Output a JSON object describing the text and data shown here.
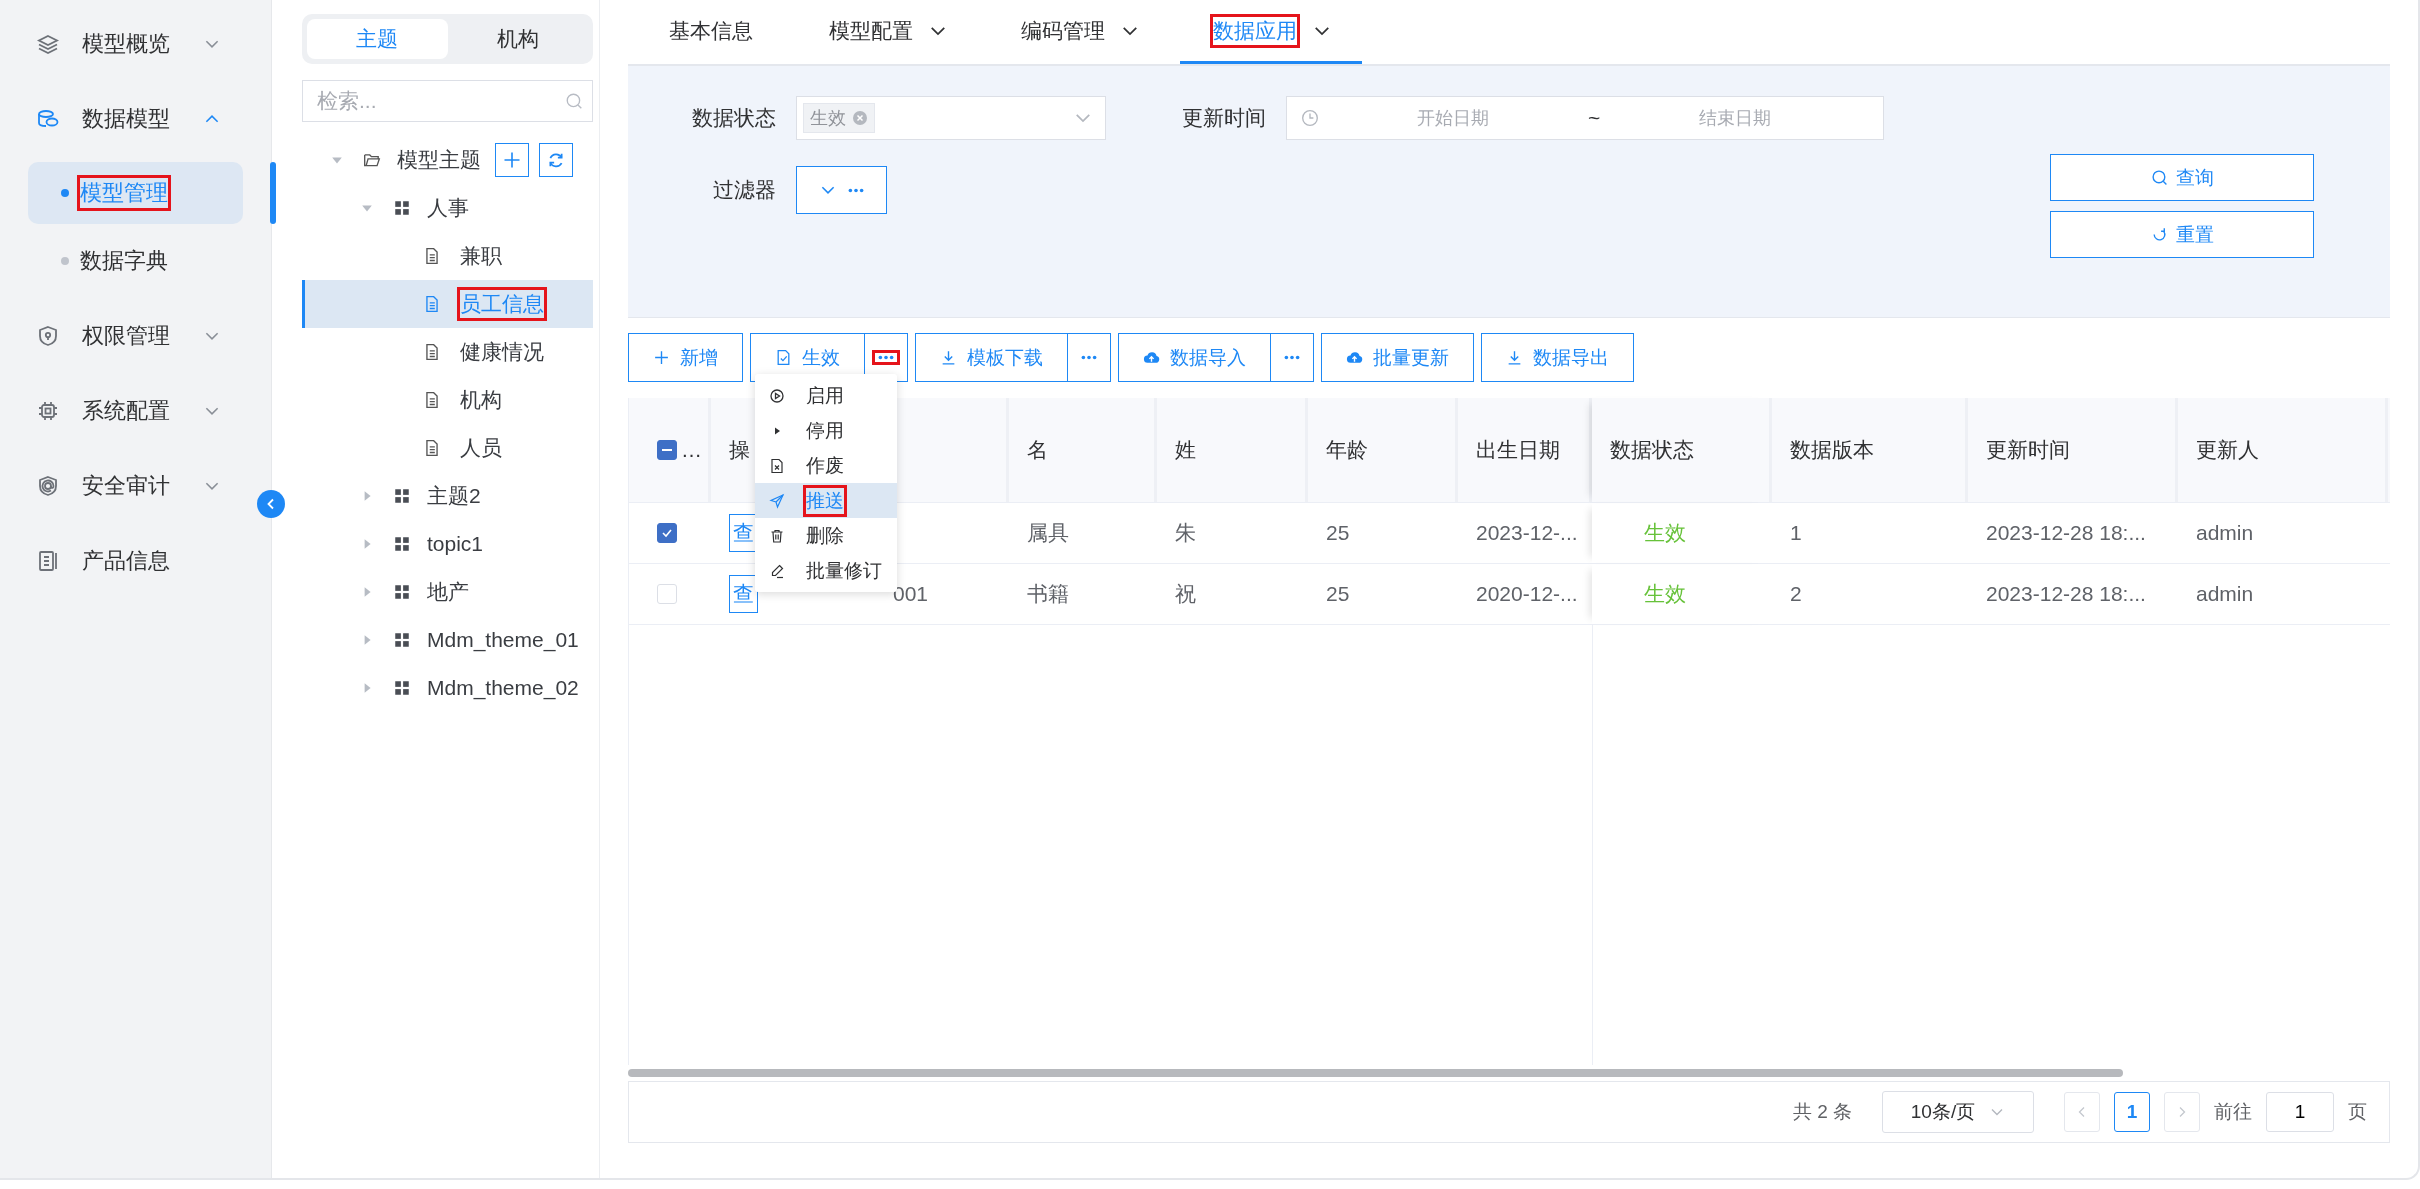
{
  "sidebar": {
    "items": [
      {
        "label": "模型概览",
        "expanded": false
      },
      {
        "label": "数据模型",
        "expanded": true,
        "children": [
          {
            "label": "模型管理",
            "selected": true,
            "highlighted": true
          },
          {
            "label": "数据字典",
            "selected": false,
            "highlighted": false
          }
        ]
      },
      {
        "label": "权限管理",
        "expanded": false
      },
      {
        "label": "系统配置",
        "expanded": false
      },
      {
        "label": "安全审计",
        "expanded": false
      },
      {
        "label": "产品信息"
      }
    ]
  },
  "tree_panel": {
    "tabs": [
      {
        "label": "主题",
        "selected": true
      },
      {
        "label": "机构",
        "selected": false
      }
    ],
    "search": {
      "placeholder": "检索..."
    },
    "tree": [
      {
        "label": "模型主题",
        "kind": "folder",
        "expanded": true,
        "children": [
          {
            "label": "人事",
            "kind": "group",
            "expanded": true,
            "children": [
              {
                "label": "兼职",
                "kind": "doc",
                "selected": false,
                "highlighted": false
              },
              {
                "label": "员工信息",
                "kind": "doc",
                "selected": true,
                "highlighted": true
              },
              {
                "label": "健康情况",
                "kind": "doc",
                "selected": false,
                "highlighted": false
              },
              {
                "label": "机构",
                "kind": "doc",
                "selected": false,
                "highlighted": false
              },
              {
                "label": "人员",
                "kind": "doc",
                "selected": false,
                "highlighted": false
              }
            ]
          },
          {
            "label": "主题2",
            "kind": "group",
            "expanded": false
          },
          {
            "label": "topic1",
            "kind": "group",
            "expanded": false
          },
          {
            "label": "地产",
            "kind": "group",
            "expanded": false
          },
          {
            "label": "Mdm_theme_01",
            "kind": "group",
            "expanded": false
          },
          {
            "label": "Mdm_theme_02",
            "kind": "group",
            "expanded": false
          }
        ]
      }
    ]
  },
  "tabs": [
    {
      "label": "基本信息",
      "selected": false,
      "has_menu": false,
      "highlighted": false
    },
    {
      "label": "模型配置",
      "selected": false,
      "has_menu": true,
      "highlighted": false
    },
    {
      "label": "编码管理",
      "selected": false,
      "has_menu": true,
      "highlighted": false
    },
    {
      "label": "数据应用",
      "selected": true,
      "has_menu": true,
      "highlighted": true
    }
  ],
  "filters": {
    "status": {
      "label": "数据状态",
      "tags": [
        "生效"
      ]
    },
    "update_time": {
      "label": "更新时间",
      "start_placeholder": "开始日期",
      "separator": "~",
      "end_placeholder": "结束日期"
    },
    "filter": {
      "label": "过滤器"
    },
    "query_button": "查询",
    "reset_button": "重置"
  },
  "toolbar": [
    {
      "label": "新增",
      "has_more": false
    },
    {
      "label": "生效",
      "has_more": true,
      "more_highlighted": true
    },
    {
      "label": "模板下载",
      "has_more": true,
      "more_highlighted": false
    },
    {
      "label": "数据导入",
      "has_more": true,
      "more_highlighted": false
    },
    {
      "label": "批量更新",
      "has_more": false
    },
    {
      "label": "数据导出",
      "has_more": false
    }
  ],
  "table": {
    "select_all": {
      "indeterminate": true,
      "label": "…"
    },
    "columns": [
      {
        "label": "操",
        "kind": "action"
      },
      {
        "kind": "text"
      },
      {
        "label": "名",
        "kind": "text"
      },
      {
        "label": "姓",
        "kind": "text"
      },
      {
        "label": "年龄",
        "kind": "text"
      },
      {
        "label": "出生日期",
        "kind": "text"
      },
      {
        "label": "数据状态",
        "kind": "status"
      },
      {
        "label": "数据版本",
        "kind": "text"
      },
      {
        "label": "更新时间",
        "kind": "text"
      },
      {
        "label": "更新人",
        "kind": "text"
      }
    ],
    "rows": [
      {
        "checked": true,
        "cells": [
          "查",
          null,
          "属具",
          "朱",
          "25",
          "2023-12-...",
          "生效",
          "1",
          "2023-12-28 18:...",
          "admin"
        ]
      },
      {
        "checked": false,
        "cells": [
          "查",
          "001",
          "书籍",
          "祝",
          "25",
          "2020-12-...",
          "生效",
          "2",
          "2023-12-28 18:...",
          "admin"
        ]
      }
    ]
  },
  "menu": {
    "items": [
      {
        "label": "启用",
        "selected": false,
        "highlighted": false
      },
      {
        "label": "停用",
        "selected": false,
        "highlighted": false
      },
      {
        "label": "作废",
        "selected": false,
        "highlighted": false
      },
      {
        "label": "推送",
        "selected": true,
        "highlighted": true
      },
      {
        "label": "删除",
        "selected": false,
        "highlighted": false
      },
      {
        "label": "批量修订",
        "selected": false,
        "highlighted": false
      }
    ]
  },
  "pagination": {
    "total": "共 2 条",
    "page_size": "10条/页",
    "pages": [
      {
        "label": "1",
        "selected": true
      }
    ],
    "goto_label": "前往",
    "goto_value": "1",
    "page_suffix": "页"
  }
}
